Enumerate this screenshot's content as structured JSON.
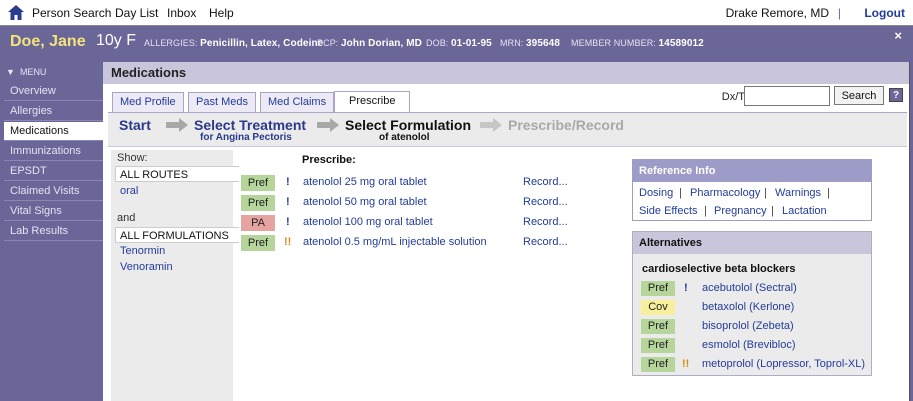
{
  "topbar": {
    "nav": [
      "Person Search",
      "Day List",
      "Inbox",
      "Help"
    ],
    "user": "Drake Remore, MD",
    "separator": "|",
    "logout": "Logout"
  },
  "patient": {
    "name": "Doe, Jane",
    "age": "10y F",
    "allergies_label": "ALLERGIES:",
    "allergies": "Penicillin, Latex, Codeine",
    "pcp_label": "PCP:",
    "pcp": "John Dorian, MD",
    "dob_label": "DOB:",
    "dob": "01-01-95",
    "mrn_label": "MRN:",
    "mrn": "395648",
    "member_label": "MEMBER NUMBER:",
    "member": "14589012",
    "close": "×"
  },
  "sidebar": {
    "menu_label": "MENU",
    "items": [
      {
        "label": "Overview"
      },
      {
        "label": "Allergies"
      },
      {
        "label": "Medications"
      },
      {
        "label": "Immunizations"
      },
      {
        "label": "EPSDT"
      },
      {
        "label": "Claimed Visits"
      },
      {
        "label": "Vital Signs"
      },
      {
        "label": "Lab Results"
      }
    ],
    "active": "Medications"
  },
  "main": {
    "title": "Medications",
    "tabs": [
      {
        "label": "Med Profile"
      },
      {
        "label": "Past Meds"
      },
      {
        "label": "Med Claims"
      },
      {
        "label": "Prescribe"
      }
    ],
    "active_tab": "Prescribe",
    "catalog": {
      "label": "Dx/Tx/Rx Catalog:",
      "value": "",
      "search_label": "Search",
      "help": "?"
    },
    "wizard": {
      "start": "Start",
      "select_treatment": "Select Treatment",
      "treatment_sub": "for Angina Pectoris",
      "select_formulation": "Select Formulation",
      "formulation_sub": "of atenolol",
      "prescribe_record": "Prescribe/Record"
    },
    "show": {
      "label": "Show:",
      "routes_label": "ALL ROUTES",
      "routes": [
        "oral"
      ],
      "and_label": "and",
      "formulations_label": "ALL FORMULATIONS",
      "formulations": [
        "Tenormin",
        "Venoramin"
      ]
    },
    "prescribe": {
      "heading": "Prescribe:",
      "items": [
        {
          "status": "Pref",
          "alert": "!",
          "drug": "atenolol 25 mg oral tablet",
          "action": "Record..."
        },
        {
          "status": "Pref",
          "alert": "!",
          "drug": "atenolol 50 mg oral tablet",
          "action": "Record..."
        },
        {
          "status": "PA",
          "alert": "!",
          "drug": "atenolol 100 mg oral tablet",
          "action": "Record..."
        },
        {
          "status": "Pref",
          "alert": "!!",
          "drug": "atenolol 0.5 mg/mL injectable solution",
          "action": "Record..."
        }
      ]
    },
    "reference": {
      "title": "Reference Info",
      "links": [
        "Dosing",
        "Pharmacology",
        "Warnings",
        "Side Effects",
        "Pregnancy",
        "Lactation"
      ],
      "separator": "|"
    },
    "alternatives": {
      "title": "Alternatives",
      "category": "cardioselective beta blockers",
      "items": [
        {
          "status": "Pref",
          "alert": "!",
          "drug": "acebutolol (Sectral)"
        },
        {
          "status": "Cov",
          "alert": "",
          "drug": "betaxolol (Kerlone)"
        },
        {
          "status": "Pref",
          "alert": "",
          "drug": "bisoprolol (Zebeta)"
        },
        {
          "status": "Pref",
          "alert": "",
          "drug": "esmolol (Brevibloc)"
        },
        {
          "status": "Pref",
          "alert": "!!",
          "drug": "metoprolol (Lopressor, Toprol-XL)"
        }
      ]
    }
  },
  "colors": {
    "frame": "#6b6698",
    "pref": "#b5d59b",
    "pa": "#e6a4a0",
    "cov": "#f7ef9c",
    "link": "#223c9a",
    "warn_alert": "#d68b12",
    "patient_name": "#f4e27a"
  }
}
